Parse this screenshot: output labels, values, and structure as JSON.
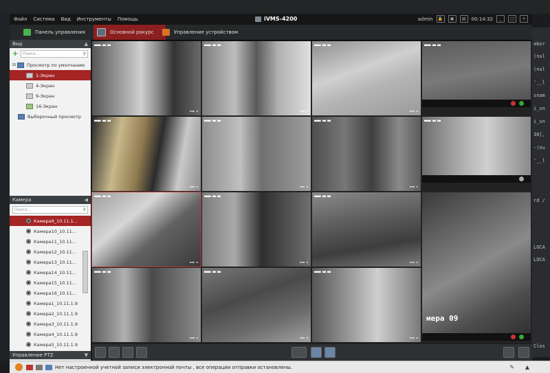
{
  "window": {
    "title": "iVMS-4200"
  },
  "menu": [
    "Файл",
    "Система",
    "Вид",
    "Инструменты",
    "Помощь"
  ],
  "tray": {
    "user": "admin",
    "time": "00:14:32"
  },
  "nav_tabs": [
    {
      "label": "Панель управления",
      "active": false
    },
    {
      "label": "Основной ракурс",
      "active": true
    },
    {
      "label": "Управление устройством",
      "active": false
    }
  ],
  "view_panel": {
    "title": "Вид",
    "search_placeholder": "Поиск...",
    "default_view": "Просмотр по умолчанию",
    "layouts": [
      "1-Экран",
      "4-Экран",
      "9-Экран",
      "16-Экран"
    ],
    "custom_view": "Выборочный просмотр"
  },
  "camera_panel": {
    "title": "Камера",
    "search_placeholder": "Поиск...",
    "cameras": [
      "Камера9_10.11.1...",
      "Камера10_10.11...",
      "Камера11_10.11...",
      "Камера12_10.11...",
      "Камера13_10.11...",
      "Камера14_10.11...",
      "Камера15_10.11...",
      "Камера16_10.11...",
      "Камера1_10.11.1.9",
      "Камера2_10.11.1.9",
      "Камера3_10.11.1.9",
      "Камера4_10.11.1.9",
      "Камера5_10.11.1.9"
    ]
  },
  "ptz_panel": {
    "title": "Управление PTZ"
  },
  "grid": {
    "overlay_text": "мера 09"
  },
  "status": {
    "message": "Нет настроенной учетной записи электронной почты , все операции отправки остановлены."
  },
  "terminal": [
    "abor",
    "(nul",
    "(nul",
    "'__l",
    "snam",
    "i_sn",
    "i_sn",
    "30],",
    "-(nu",
    "'__l",
    "rd /",
    "LOCA",
    "LOCA",
    "Clos"
  ],
  "colors": {
    "accent": "#8c1f1f",
    "selection": "#a52424"
  }
}
